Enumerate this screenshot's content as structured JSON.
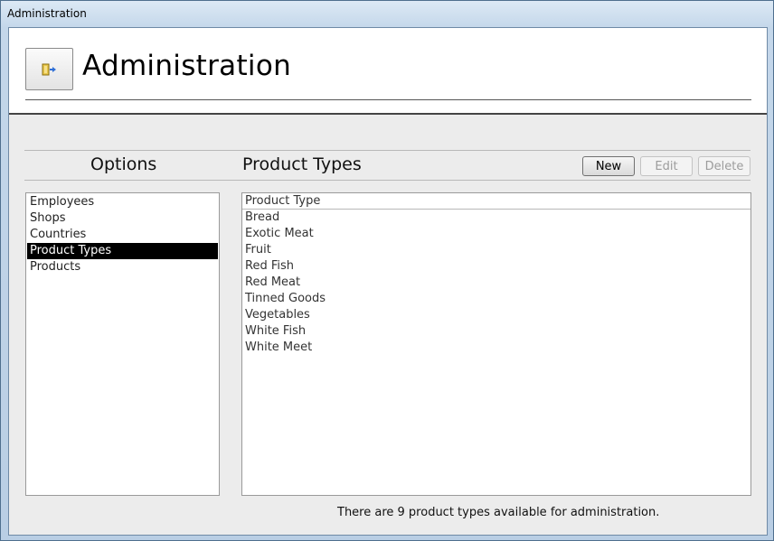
{
  "window": {
    "title": "Administration"
  },
  "header": {
    "title": "Administration",
    "icon": "exit-door-icon"
  },
  "options": {
    "heading": "Options",
    "items": [
      {
        "label": "Employees",
        "selected": false
      },
      {
        "label": "Shops",
        "selected": false
      },
      {
        "label": "Countries",
        "selected": false
      },
      {
        "label": "Product Types",
        "selected": true
      },
      {
        "label": "Products",
        "selected": false
      }
    ]
  },
  "panel": {
    "heading": "Product Types",
    "buttons": {
      "new": "New",
      "edit": "Edit",
      "delete": "Delete"
    },
    "column_header": "Product Type",
    "rows": [
      "Bread",
      "Exotic Meat",
      "Fruit",
      "Red Fish",
      "Red Meat",
      "Tinned Goods",
      "Vegetables",
      "White Fish",
      "White Meet"
    ]
  },
  "status": "There are 9 product types available for administration."
}
